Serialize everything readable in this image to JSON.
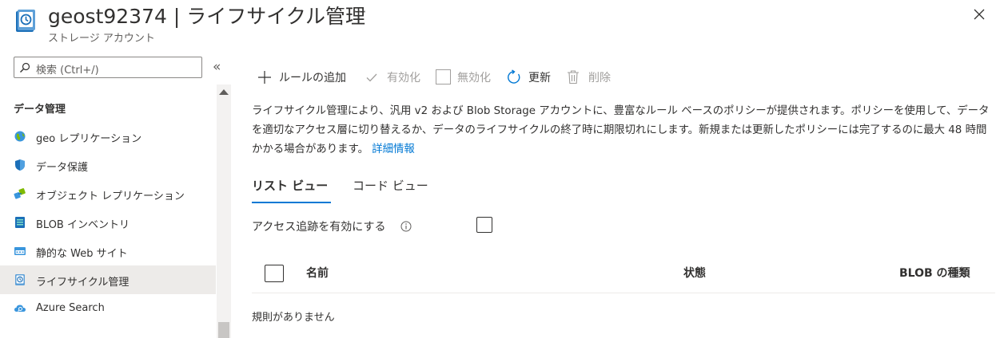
{
  "header": {
    "title": "geost92374 | ライフサイクル管理",
    "subtitle": "ストレージ アカウント",
    "more_label": "···"
  },
  "sidebar": {
    "search_placeholder": "検索 (Ctrl+/)",
    "collapse_label": "«",
    "section_title": "データ管理",
    "items": [
      {
        "label": "geo レプリケーション",
        "icon": "globe-icon"
      },
      {
        "label": "データ保護",
        "icon": "shield-icon"
      },
      {
        "label": "オブジェクト レプリケーション",
        "icon": "object-replication-icon"
      },
      {
        "label": "BLOB インベントリ",
        "icon": "blob-inventory-icon"
      },
      {
        "label": "静的な Web サイト",
        "icon": "static-website-icon"
      },
      {
        "label": "ライフサイクル管理",
        "icon": "lifecycle-icon",
        "selected": true
      },
      {
        "label": "Azure Search",
        "icon": "azure-search-icon"
      }
    ]
  },
  "toolbar": {
    "add_rule": "ルールの追加",
    "enable": "有効化",
    "disable": "無効化",
    "refresh": "更新",
    "delete": "削除"
  },
  "description": {
    "text": "ライフサイクル管理により、汎用 v2 および Blob Storage アカウントに、豊富なルール ベースのポリシーが提供されます。ポリシーを使用して、データを適切なアクセス層に切り替えるか、データのライフサイクルの終了時に期限切れにします。新規または更新したポリシーには完了するのに最大 48 時間かかる場合があります。",
    "link": "詳細情報"
  },
  "tabs": [
    {
      "label": "リスト ビュー",
      "active": true
    },
    {
      "label": "コード ビュー",
      "active": false
    }
  ],
  "access_tracking": {
    "label": "アクセス追跡を有効にする",
    "checked": false
  },
  "table": {
    "columns": [
      "名前",
      "状態",
      "BLOB の種類"
    ],
    "empty_text": "規則がありません"
  },
  "colors": {
    "accent": "#0078d4",
    "selected_bg": "#edebe9",
    "disabled_text": "#a19f9d"
  }
}
